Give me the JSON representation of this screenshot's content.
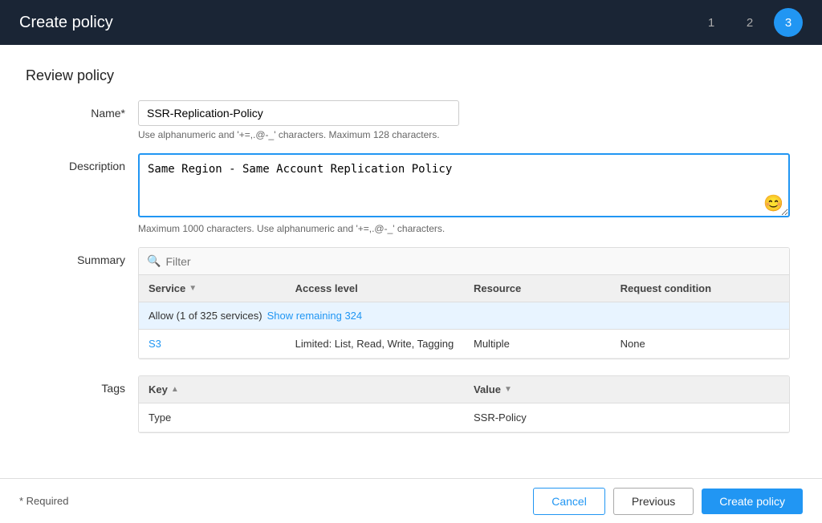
{
  "header": {
    "title": "Create policy",
    "steps": [
      {
        "label": "1",
        "active": false
      },
      {
        "label": "2",
        "active": false
      },
      {
        "label": "3",
        "active": true
      }
    ]
  },
  "page": {
    "section_title": "Review policy",
    "name_label": "Name*",
    "name_value": "SSR-Replication-Policy",
    "name_hint": "Use alphanumeric and '+=,.@-_' characters. Maximum 128 characters.",
    "description_label": "Description",
    "description_value": "Same Region - Same Account Replication Policy",
    "description_hint": "Maximum 1000 characters. Use alphanumeric and '+=,.@-_' characters.",
    "summary_label": "Summary",
    "filter_placeholder": "Filter",
    "table": {
      "columns": [
        "Service",
        "Access level",
        "Resource",
        "Request condition"
      ],
      "group_row": "Allow (1 of 325 services)",
      "show_remaining_label": "Show remaining 324",
      "rows": [
        {
          "service": "S3",
          "access_level": "Limited: List, Read, Write, Tagging",
          "resource": "Multiple",
          "condition": "None"
        }
      ]
    },
    "tags_label": "Tags",
    "tags_table": {
      "columns": [
        "Key",
        "Value"
      ],
      "rows": [
        {
          "key": "Type",
          "value": "SSR-Policy"
        }
      ]
    }
  },
  "footer": {
    "required_note": "* Required",
    "cancel_label": "Cancel",
    "previous_label": "Previous",
    "create_label": "Create policy"
  }
}
